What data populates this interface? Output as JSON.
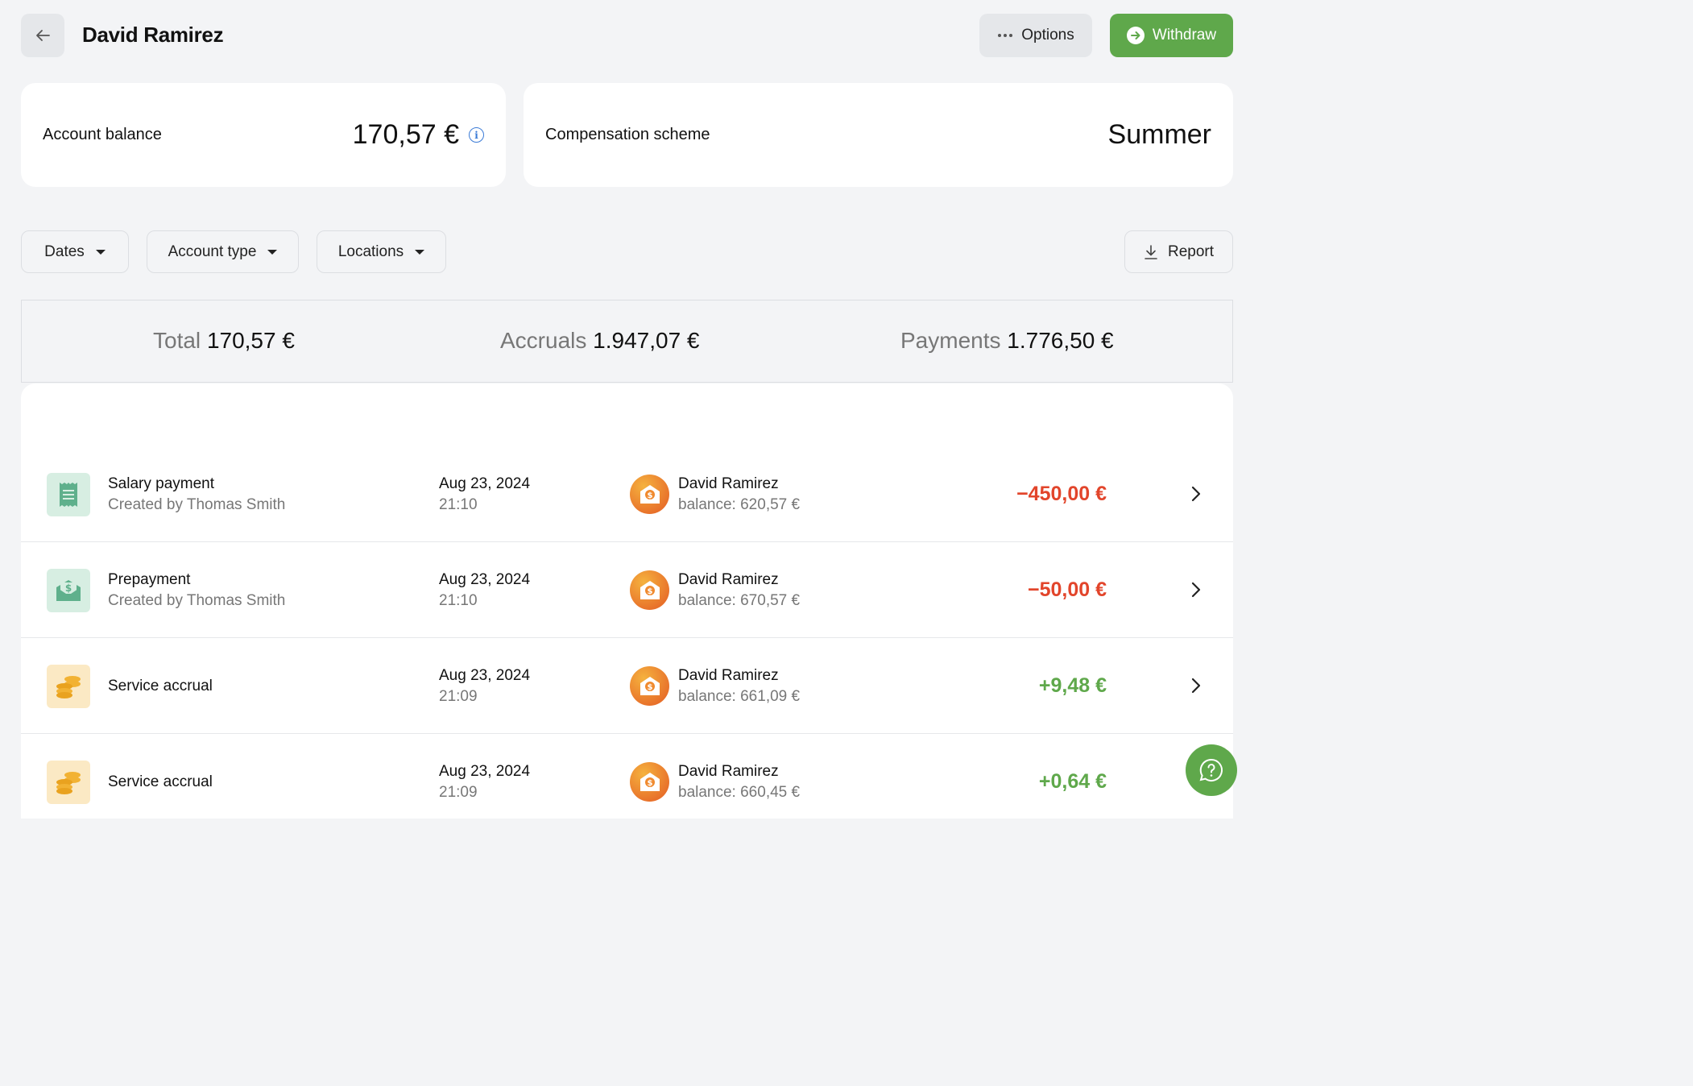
{
  "header": {
    "title": "David Ramirez",
    "options_label": "Options",
    "withdraw_label": "Withdraw"
  },
  "balance_card": {
    "label": "Account balance",
    "value": "170,57 €"
  },
  "scheme_card": {
    "label": "Compensation scheme",
    "value": "Summer"
  },
  "filters": {
    "dates": "Dates",
    "account_type": "Account type",
    "locations": "Locations",
    "report": "Report"
  },
  "summary": {
    "total_label": "Total",
    "total_value": "170,57 €",
    "accruals_label": "Accruals",
    "accruals_value": "1.947,07 €",
    "payments_label": "Payments",
    "payments_value": "1.776,50 €"
  },
  "transactions": [
    {
      "title": "Salary payment",
      "subtitle": "Created by Thomas Smith",
      "date": "Aug 23, 2024",
      "time": "21:10",
      "person": "David Ramirez",
      "balance": "balance: 620,57 €",
      "amount": "−450,00 €",
      "kind": "negative",
      "icon": "receipt-icon"
    },
    {
      "title": "Prepayment",
      "subtitle": "Created by Thomas Smith",
      "date": "Aug 23, 2024",
      "time": "21:10",
      "person": "David Ramirez",
      "balance": "balance: 670,57 €",
      "amount": "−50,00 €",
      "kind": "negative",
      "icon": "envelope-money-icon"
    },
    {
      "title": "Service accrual",
      "subtitle": "",
      "date": "Aug 23, 2024",
      "time": "21:09",
      "person": "David Ramirez",
      "balance": "balance: 661,09 €",
      "amount": "+9,48 €",
      "kind": "positive",
      "icon": "coins-icon"
    },
    {
      "title": "Service accrual",
      "subtitle": "",
      "date": "Aug 23, 2024",
      "time": "21:09",
      "person": "David Ramirez",
      "balance": "balance: 660,45 €",
      "amount": "+0,64 €",
      "kind": "positive",
      "icon": "coins-icon"
    }
  ],
  "colors": {
    "accent_green": "#5fa84b",
    "negative_red": "#e2452b",
    "info_blue": "#3b7bd6"
  }
}
